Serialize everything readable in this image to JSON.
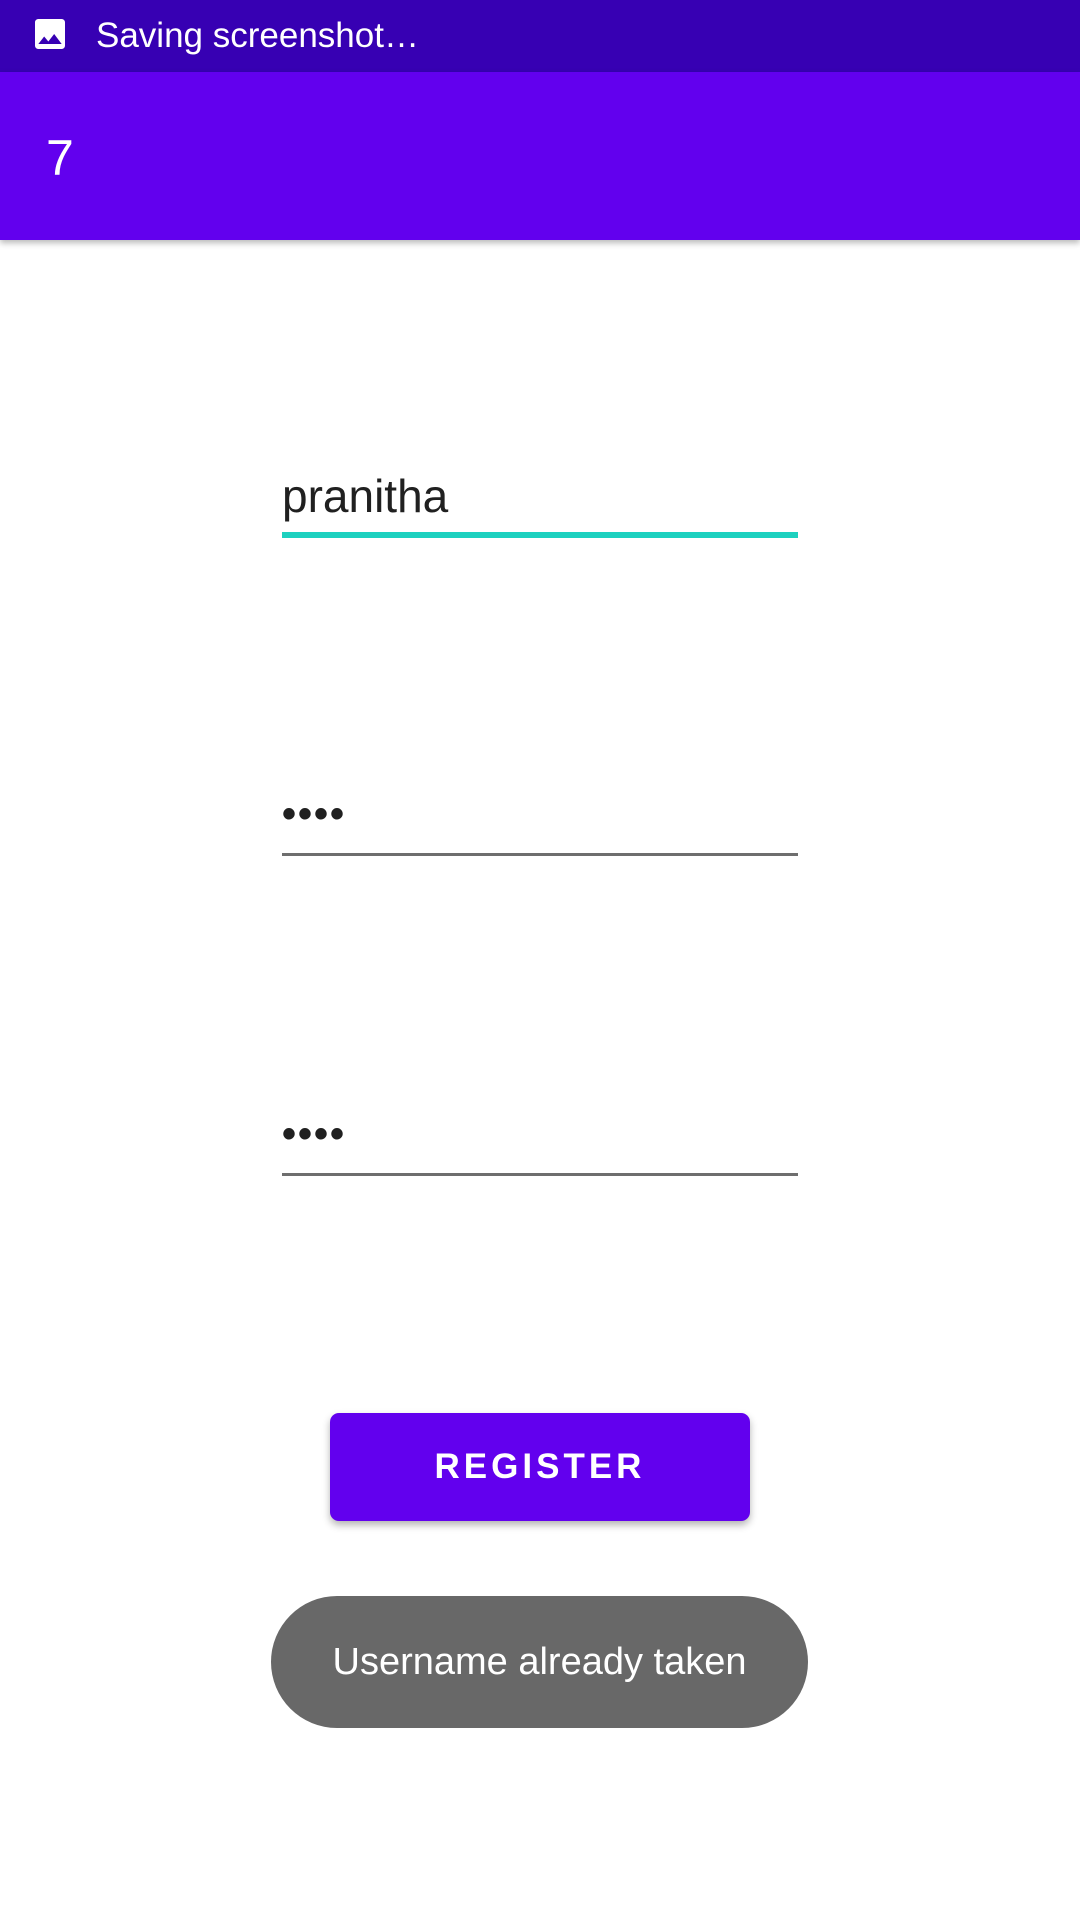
{
  "status_bar": {
    "notification_icon": "image-icon",
    "text": "Saving screenshot…",
    "background": "#3700b3"
  },
  "app_bar": {
    "title": "7",
    "background": "#6200ee"
  },
  "form": {
    "username_value": "pranitha",
    "password_value": "••••",
    "confirm_password_value": "••••",
    "focus_accent": "#1dd1bf"
  },
  "register_button": {
    "label": "REGISTER",
    "background": "#6200ee"
  },
  "toast": {
    "message": "Username already taken"
  }
}
